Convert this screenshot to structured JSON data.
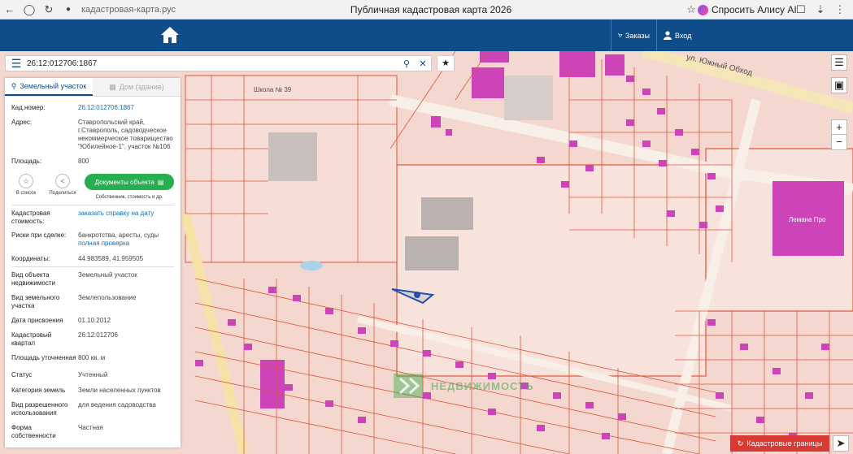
{
  "browser": {
    "url": "кадастровая-карта.рус",
    "tab_title": "Публичная кадастровая карта 2026",
    "alice_label": "Спросить Алису AI"
  },
  "header": {
    "orders_label": "Заказы",
    "login_label": "Вход"
  },
  "search": {
    "value": "26:12:012706:1867"
  },
  "panel": {
    "tabs": [
      "Земельный участок",
      "Дом (здание)"
    ],
    "cad_number_label": "Кад.номер:",
    "cad_number_value": "26:12:012706:1867",
    "address_label": "Адрес:",
    "address_value": "Ставропольский край, г.Ставрополь, садоводческое некоммерческое товарищество \"Юбилейное-1\", участок №106",
    "area_label": "Площадь:",
    "area_value": "800",
    "actions": {
      "list_label": "В список",
      "share_label": "Поделиться",
      "docs_label": "Документы объекта",
      "docs_sub": "Собственник, стоимость и др."
    },
    "rows": [
      {
        "label": "Кадастровая стоимость:",
        "value": "заказать справку на дату",
        "link": true
      },
      {
        "label": "Риски при сделке:",
        "value": "банкротства, аресты, суды",
        "extra": "полная проверка"
      },
      {
        "label": "Координаты:",
        "value": "44.983589, 41.959505"
      },
      {
        "label": "Вид объекта недвижимости",
        "value": "Земельный участок"
      },
      {
        "label": "Вид земельного участка",
        "value": "Землепользование"
      },
      {
        "label": "Дата присвоения",
        "value": "01.10.2012"
      },
      {
        "label": "Кадастровый квартал",
        "value": "26:12:012706"
      },
      {
        "label": "Площадь уточненная",
        "value": "800 кв. м"
      },
      {
        "label": "Статус",
        "value": "Учтенный"
      },
      {
        "label": "Категория земель",
        "value": "Земли населенных пунктов"
      },
      {
        "label": "Вид разрешенного использования",
        "value": "для ведения садоводства"
      },
      {
        "label": "Форма собственности",
        "value": "Частная"
      }
    ]
  },
  "map": {
    "street_label": "ул. Южный Обход",
    "school_label": "Школа № 39",
    "store_label": "Лемана Про",
    "watermark": "НЕДВИЖИМОСТЬ",
    "cadastral_borders_label": "Кадастровые границы",
    "zoom_in": "+",
    "zoom_out": "−"
  }
}
